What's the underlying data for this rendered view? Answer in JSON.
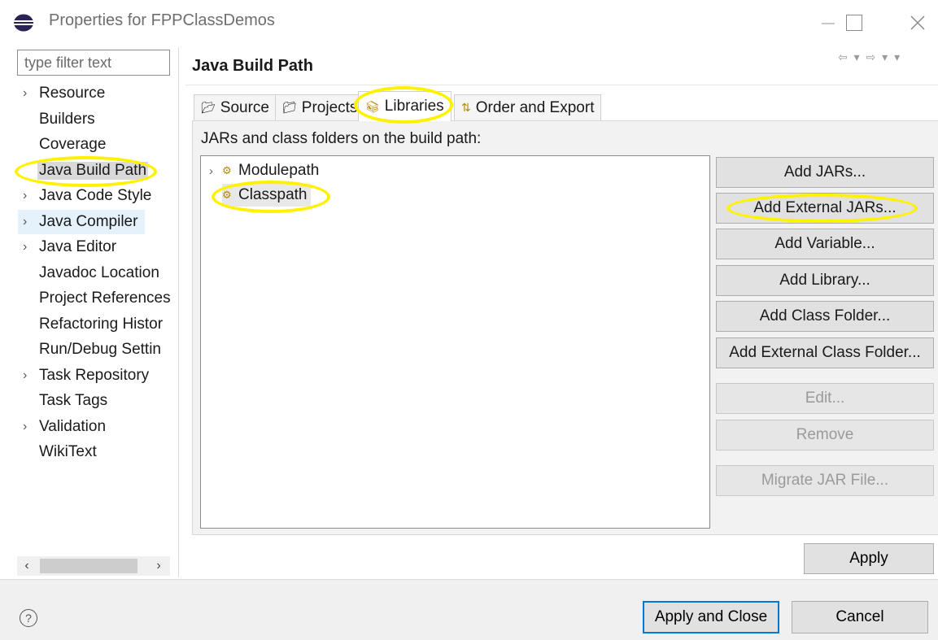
{
  "window": {
    "title": "Properties for FPPClassDemos",
    "icon": "eclipse-icon"
  },
  "sidebar": {
    "filter_placeholder": "type filter text",
    "items": [
      {
        "label": "Resource",
        "expandable": true
      },
      {
        "label": "Builders",
        "expandable": false
      },
      {
        "label": "Coverage",
        "expandable": false
      },
      {
        "label": "Java Build Path",
        "expandable": false,
        "selected": true
      },
      {
        "label": "Java Code Style",
        "expandable": true
      },
      {
        "label": "Java Compiler",
        "expandable": true,
        "hover": true
      },
      {
        "label": "Java Editor",
        "expandable": true
      },
      {
        "label": "Javadoc Location",
        "expandable": false
      },
      {
        "label": "Project References",
        "expandable": false
      },
      {
        "label": "Refactoring Histor",
        "expandable": false
      },
      {
        "label": "Run/Debug Settin",
        "expandable": false
      },
      {
        "label": "Task Repository",
        "expandable": true
      },
      {
        "label": "Task Tags",
        "expandable": false
      },
      {
        "label": "Validation",
        "expandable": true
      },
      {
        "label": "WikiText",
        "expandable": false
      }
    ]
  },
  "main": {
    "title": "Java Build Path",
    "tabs": [
      {
        "label": "Source",
        "icon": "source-folder-icon"
      },
      {
        "label": "Projects",
        "icon": "project-icon"
      },
      {
        "label": "Libraries",
        "icon": "libraries-icon",
        "active": true
      },
      {
        "label": "Order and Export",
        "icon": "order-export-icon"
      }
    ],
    "panel_label": "JARs and class folders on the build path:",
    "tree": [
      {
        "label": "Modulepath",
        "expandable": true
      },
      {
        "label": "Classpath",
        "expandable": false,
        "selected": true
      }
    ],
    "buttons": {
      "add_jars": "Add JARs...",
      "add_external_jars": "Add External JARs...",
      "add_variable": "Add Variable...",
      "add_library": "Add Library...",
      "add_class_folder": "Add Class Folder...",
      "add_external_class_folder": "Add External Class Folder...",
      "edit": "Edit...",
      "remove": "Remove",
      "migrate_jar": "Migrate JAR File..."
    },
    "apply": "Apply"
  },
  "footer": {
    "apply_and_close": "Apply and Close",
    "cancel": "Cancel"
  },
  "colors": {
    "highlight": "#fff200",
    "default_button_border": "#0078d7",
    "selection_bg": "#d9d9d9"
  }
}
